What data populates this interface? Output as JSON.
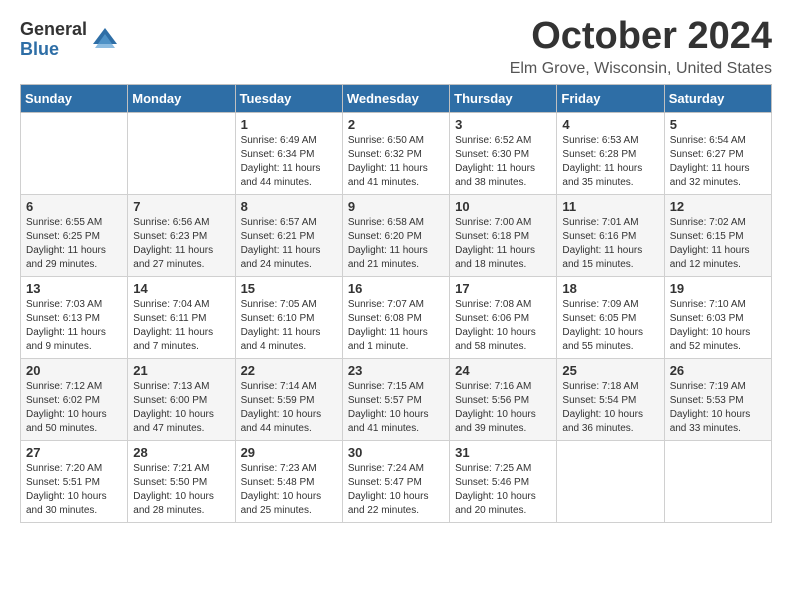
{
  "logo": {
    "general": "General",
    "blue": "Blue"
  },
  "title": "October 2024",
  "location": "Elm Grove, Wisconsin, United States",
  "days_of_week": [
    "Sunday",
    "Monday",
    "Tuesday",
    "Wednesday",
    "Thursday",
    "Friday",
    "Saturday"
  ],
  "weeks": [
    [
      {
        "day": "",
        "info": ""
      },
      {
        "day": "",
        "info": ""
      },
      {
        "day": "1",
        "info": "Sunrise: 6:49 AM\nSunset: 6:34 PM\nDaylight: 11 hours and 44 minutes."
      },
      {
        "day": "2",
        "info": "Sunrise: 6:50 AM\nSunset: 6:32 PM\nDaylight: 11 hours and 41 minutes."
      },
      {
        "day": "3",
        "info": "Sunrise: 6:52 AM\nSunset: 6:30 PM\nDaylight: 11 hours and 38 minutes."
      },
      {
        "day": "4",
        "info": "Sunrise: 6:53 AM\nSunset: 6:28 PM\nDaylight: 11 hours and 35 minutes."
      },
      {
        "day": "5",
        "info": "Sunrise: 6:54 AM\nSunset: 6:27 PM\nDaylight: 11 hours and 32 minutes."
      }
    ],
    [
      {
        "day": "6",
        "info": "Sunrise: 6:55 AM\nSunset: 6:25 PM\nDaylight: 11 hours and 29 minutes."
      },
      {
        "day": "7",
        "info": "Sunrise: 6:56 AM\nSunset: 6:23 PM\nDaylight: 11 hours and 27 minutes."
      },
      {
        "day": "8",
        "info": "Sunrise: 6:57 AM\nSunset: 6:21 PM\nDaylight: 11 hours and 24 minutes."
      },
      {
        "day": "9",
        "info": "Sunrise: 6:58 AM\nSunset: 6:20 PM\nDaylight: 11 hours and 21 minutes."
      },
      {
        "day": "10",
        "info": "Sunrise: 7:00 AM\nSunset: 6:18 PM\nDaylight: 11 hours and 18 minutes."
      },
      {
        "day": "11",
        "info": "Sunrise: 7:01 AM\nSunset: 6:16 PM\nDaylight: 11 hours and 15 minutes."
      },
      {
        "day": "12",
        "info": "Sunrise: 7:02 AM\nSunset: 6:15 PM\nDaylight: 11 hours and 12 minutes."
      }
    ],
    [
      {
        "day": "13",
        "info": "Sunrise: 7:03 AM\nSunset: 6:13 PM\nDaylight: 11 hours and 9 minutes."
      },
      {
        "day": "14",
        "info": "Sunrise: 7:04 AM\nSunset: 6:11 PM\nDaylight: 11 hours and 7 minutes."
      },
      {
        "day": "15",
        "info": "Sunrise: 7:05 AM\nSunset: 6:10 PM\nDaylight: 11 hours and 4 minutes."
      },
      {
        "day": "16",
        "info": "Sunrise: 7:07 AM\nSunset: 6:08 PM\nDaylight: 11 hours and 1 minute."
      },
      {
        "day": "17",
        "info": "Sunrise: 7:08 AM\nSunset: 6:06 PM\nDaylight: 10 hours and 58 minutes."
      },
      {
        "day": "18",
        "info": "Sunrise: 7:09 AM\nSunset: 6:05 PM\nDaylight: 10 hours and 55 minutes."
      },
      {
        "day": "19",
        "info": "Sunrise: 7:10 AM\nSunset: 6:03 PM\nDaylight: 10 hours and 52 minutes."
      }
    ],
    [
      {
        "day": "20",
        "info": "Sunrise: 7:12 AM\nSunset: 6:02 PM\nDaylight: 10 hours and 50 minutes."
      },
      {
        "day": "21",
        "info": "Sunrise: 7:13 AM\nSunset: 6:00 PM\nDaylight: 10 hours and 47 minutes."
      },
      {
        "day": "22",
        "info": "Sunrise: 7:14 AM\nSunset: 5:59 PM\nDaylight: 10 hours and 44 minutes."
      },
      {
        "day": "23",
        "info": "Sunrise: 7:15 AM\nSunset: 5:57 PM\nDaylight: 10 hours and 41 minutes."
      },
      {
        "day": "24",
        "info": "Sunrise: 7:16 AM\nSunset: 5:56 PM\nDaylight: 10 hours and 39 minutes."
      },
      {
        "day": "25",
        "info": "Sunrise: 7:18 AM\nSunset: 5:54 PM\nDaylight: 10 hours and 36 minutes."
      },
      {
        "day": "26",
        "info": "Sunrise: 7:19 AM\nSunset: 5:53 PM\nDaylight: 10 hours and 33 minutes."
      }
    ],
    [
      {
        "day": "27",
        "info": "Sunrise: 7:20 AM\nSunset: 5:51 PM\nDaylight: 10 hours and 30 minutes."
      },
      {
        "day": "28",
        "info": "Sunrise: 7:21 AM\nSunset: 5:50 PM\nDaylight: 10 hours and 28 minutes."
      },
      {
        "day": "29",
        "info": "Sunrise: 7:23 AM\nSunset: 5:48 PM\nDaylight: 10 hours and 25 minutes."
      },
      {
        "day": "30",
        "info": "Sunrise: 7:24 AM\nSunset: 5:47 PM\nDaylight: 10 hours and 22 minutes."
      },
      {
        "day": "31",
        "info": "Sunrise: 7:25 AM\nSunset: 5:46 PM\nDaylight: 10 hours and 20 minutes."
      },
      {
        "day": "",
        "info": ""
      },
      {
        "day": "",
        "info": ""
      }
    ]
  ]
}
